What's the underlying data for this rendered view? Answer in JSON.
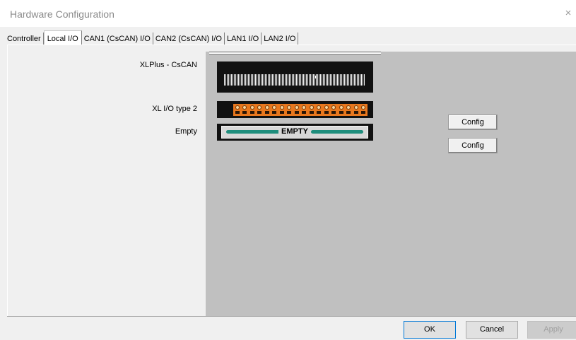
{
  "window": {
    "title": "Hardware Configuration",
    "close_glyph": "×"
  },
  "tabs": [
    {
      "label": "Controller",
      "active": false
    },
    {
      "label": "Local I/O",
      "active": true
    },
    {
      "label": "CAN1 (CsCAN) I/O",
      "active": false
    },
    {
      "label": "CAN2 (CsCAN) I/O",
      "active": false
    },
    {
      "label": "LAN1 I/O",
      "active": false
    },
    {
      "label": "LAN2 I/O",
      "active": false
    }
  ],
  "slots": [
    {
      "label": "XLPlus - CsCAN",
      "module": "cpu"
    },
    {
      "label": "XL I/O type 2",
      "module": "io",
      "config_label": "Config"
    },
    {
      "label": "Empty",
      "module": "empty",
      "module_text": "EMPTY",
      "config_label": "Config"
    }
  ],
  "footer": {
    "ok_label": "OK",
    "cancel_label": "Cancel",
    "apply_label": "Apply"
  },
  "colors": {
    "rack_background": "#c0c0c0",
    "io_terminal": "#e8771d",
    "empty_bar": "#1e8d7c"
  }
}
